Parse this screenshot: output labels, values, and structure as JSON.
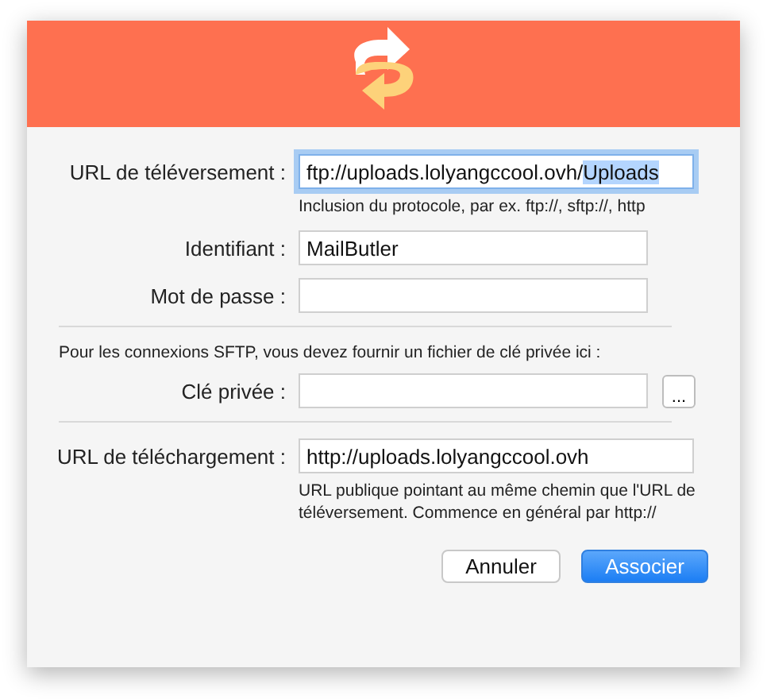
{
  "sections": [
    {
      "rows": [
        {
          "kind": "long",
          "label": "URL de téléversement :",
          "focused": true,
          "value_parts": [
            {
              "text": "ftp://uploads.lolyangccool.ovh/",
              "selected": false
            },
            {
              "text": "Uploads",
              "selected": true
            }
          ],
          "hint": "Inclusion du protocole, par ex. ftp://, sftp://, http"
        },
        {
          "kind": "short",
          "label": "Identifiant :",
          "focused": false,
          "value_parts": [
            {
              "text": "MailButler",
              "selected": false
            }
          ]
        },
        {
          "kind": "short",
          "label": "Mot de passe :",
          "focused": false
        }
      ]
    },
    {
      "note": "Pour les connexions SFTP, vous devez fournir un fichier de clé privée ici :",
      "rows": [
        {
          "kind": "browse",
          "label": "Clé privée :",
          "focused": false,
          "browse_label": "..."
        }
      ]
    },
    {
      "rows": [
        {
          "kind": "long",
          "label": "URL de téléchargement :",
          "focused": false,
          "value_parts": [
            {
              "text": "http://uploads.lolyangccool.ovh",
              "selected": false
            }
          ],
          "hint": "URL publique pointant au même chemin que l'URL de téléversement. Commence en général par http://"
        }
      ]
    }
  ],
  "buttons": [
    {
      "label": "Annuler",
      "default": false
    },
    {
      "label": "Associer",
      "default": true
    }
  ]
}
